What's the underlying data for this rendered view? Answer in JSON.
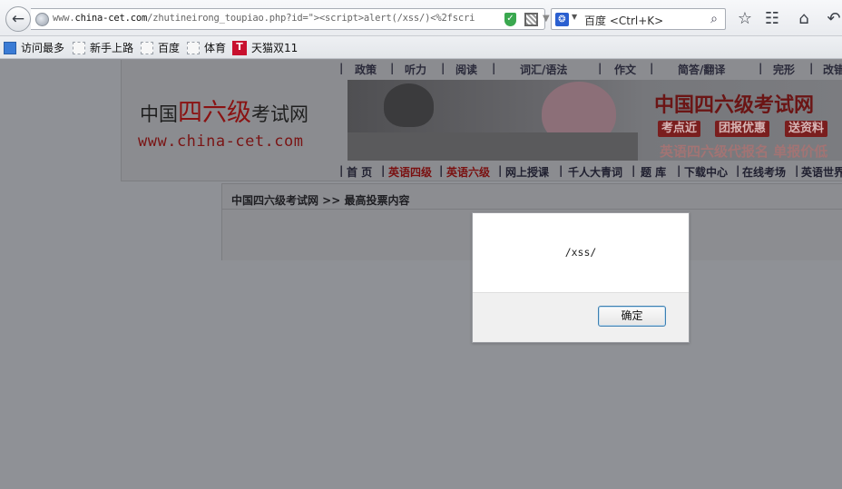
{
  "browser": {
    "url_prefix": "www.",
    "url_domain": "china-cet.com",
    "url_rest": "/zhutineirong_toupiao.php?id=\"><script>alert(/xss/)<%2fscri",
    "search_engine": "百度",
    "search_placeholder": "百度 <Ctrl+K>",
    "icons": [
      "back-arrow-icon",
      "globe-icon",
      "shield-icon",
      "qr-code-icon",
      "dropdown-icon",
      "close-icon",
      "baidu-icon",
      "magnifier-icon",
      "star-icon",
      "reader-icon",
      "home-icon",
      "undo-icon"
    ]
  },
  "bookmarks": [
    {
      "label": "访问最多",
      "icon": "folder-icon"
    },
    {
      "label": "新手上路",
      "icon": "page-icon"
    },
    {
      "label": "百度",
      "icon": "page-icon"
    },
    {
      "label": "体育",
      "icon": "page-icon"
    },
    {
      "label": "天猫双11",
      "icon": "tmall-icon"
    }
  ],
  "site": {
    "logo_prefix": "中国",
    "logo_red": "四六级",
    "logo_suffix": "考试网",
    "logo_url": "www.china-cet.com",
    "top_nav": [
      "|",
      "政策",
      "|",
      "听力",
      "|",
      "阅读",
      "|",
      "词汇/语法",
      "|",
      "作文",
      "|",
      "简答/翻译",
      "|",
      "完形",
      "|",
      "改错"
    ],
    "banner_title": "中国四六级考试网",
    "banner_tags": [
      "考点近",
      "团报优惠",
      "送资料"
    ],
    "banner_sub": "英语四六级代报名 单报价低",
    "sub_nav": [
      "|",
      "首 页",
      "|",
      "英语四级",
      "|",
      "英语六级",
      "|",
      "网上授课",
      "|",
      "千人大青词",
      "|",
      "题 库",
      "|",
      "下载中心",
      "|",
      "在线考场",
      "|",
      "英语世界"
    ],
    "breadcrumb": "中国四六级考试网 >> 最高投票内容"
  },
  "dialog": {
    "message": "/xss/",
    "ok_label": "确定"
  },
  "colors": {
    "overlay_background": "#8f9196",
    "accent_red": "#7a1414",
    "dialog_button_border": "#3c7fb1"
  }
}
